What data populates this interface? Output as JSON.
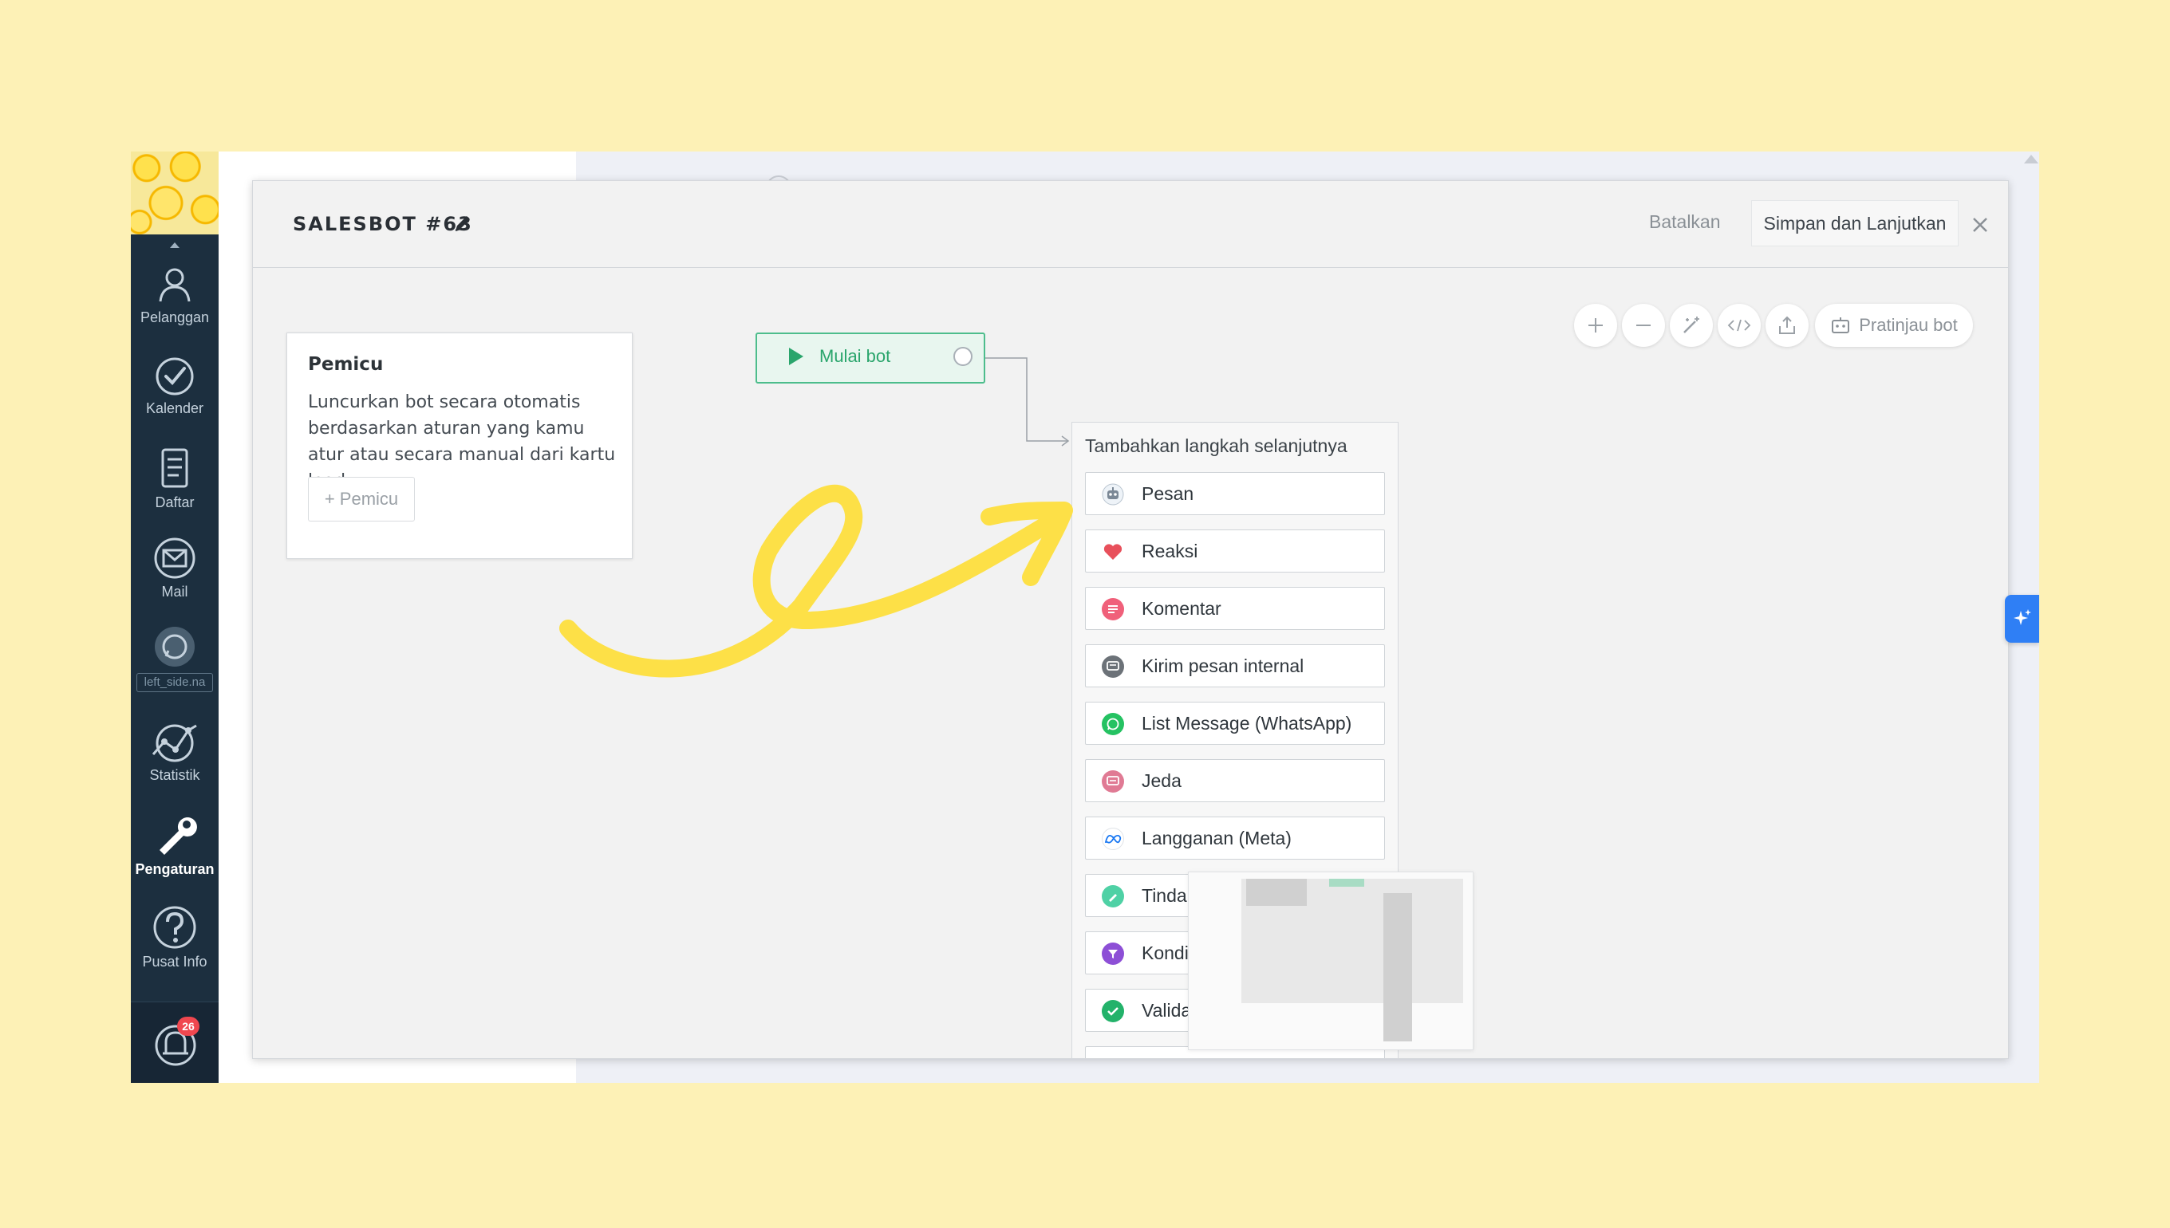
{
  "sidebar": {
    "items": [
      {
        "label": "Pelanggan",
        "icon": "customers-icon"
      },
      {
        "label": "Kalender",
        "icon": "calendar-check-icon"
      },
      {
        "label": "Daftar",
        "icon": "list-icon"
      },
      {
        "label": "Mail",
        "icon": "mail-icon"
      },
      {
        "label": "left_side.na",
        "icon": "whatsapp-icon"
      },
      {
        "label": "Statistik",
        "icon": "statistics-icon"
      },
      {
        "label": "Pengaturan",
        "icon": "settings-icon",
        "active": true
      },
      {
        "label": "Pusat Info",
        "icon": "help-icon"
      }
    ],
    "notification_count": "26"
  },
  "modal": {
    "title": "SALESBOT #63",
    "cancel_label": "Batalkan",
    "save_label": "Simpan dan Lanjutkan"
  },
  "toolbar": {
    "preview_label": "Pratinjau bot"
  },
  "trigger": {
    "title": "Pemicu",
    "description": "Luncurkan bot secara otomatis berdasarkan aturan yang kamu atur atau secara manual dari kartu lead",
    "button_label": "+ Pemicu"
  },
  "start_node": {
    "label": "Mulai bot"
  },
  "steps": {
    "title": "Tambahkan langkah selanjutnya",
    "items": [
      {
        "label": "Pesan",
        "icon": "robot-icon",
        "color": "#7b8896"
      },
      {
        "label": "Reaksi",
        "icon": "heart-icon",
        "color": "#e8505b"
      },
      {
        "label": "Komentar",
        "icon": "comment-icon",
        "color": "#f0607a"
      },
      {
        "label": "Kirim pesan internal",
        "icon": "internal-message-icon",
        "color": "#6c7278"
      },
      {
        "label": "List Message (WhatsApp)",
        "icon": "whatsapp-icon",
        "color": "#25c262"
      },
      {
        "label": "Jeda",
        "icon": "pause-icon",
        "color": "#e07a94"
      },
      {
        "label": "Langganan (Meta)",
        "icon": "meta-icon",
        "color": "#1877f2"
      },
      {
        "label": "Tindakan",
        "icon": "action-icon",
        "color": "#4fd1a5"
      },
      {
        "label": "Kondisi",
        "icon": "filter-icon",
        "color": "#8d4fd6"
      },
      {
        "label": "Validasi",
        "icon": "check-icon",
        "color": "#23b26a"
      }
    ]
  },
  "colors": {
    "background": "#fdf1b6",
    "sidebar": "#1c2f3f",
    "accent_green": "#4dbd8c",
    "scribble": "#fde047"
  }
}
